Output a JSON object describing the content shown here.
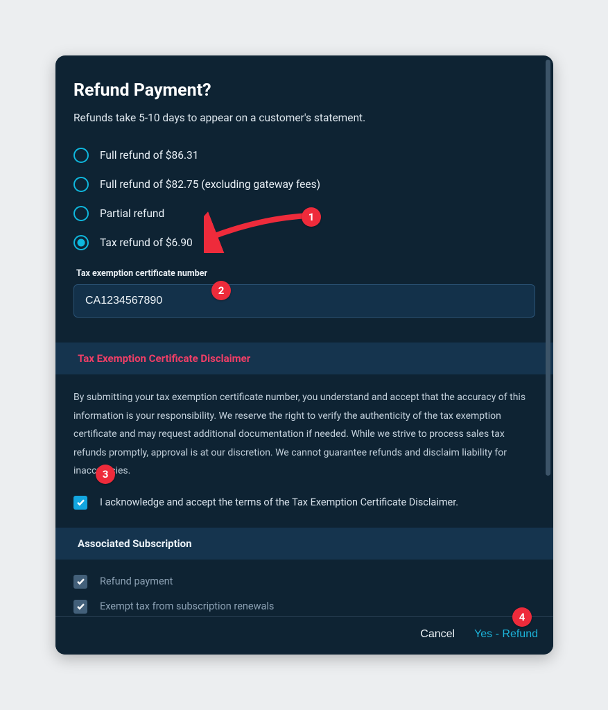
{
  "modal": {
    "title": "Refund Payment?",
    "subtitle": "Refunds take 5-10 days to appear on a customer's statement.",
    "options": [
      {
        "label": "Full refund of $86.31",
        "selected": false
      },
      {
        "label": "Full refund of $82.75 (excluding gateway fees)",
        "selected": false
      },
      {
        "label": "Partial refund",
        "selected": false
      },
      {
        "label": "Tax refund of $6.90",
        "selected": true
      }
    ],
    "cert_field": {
      "label": "Tax exemption certificate number",
      "value": "CA1234567890"
    },
    "disclaimer_heading": "Tax Exemption Certificate Disclaimer",
    "disclaimer_body": "By submitting your tax exemption certificate number, you understand and accept that the accuracy of this information is your responsibility. We reserve the right to verify the authenticity of the tax exemption certificate and may request additional documentation if needed. While we strive to process sales tax refunds promptly, approval is at our discretion. We cannot guarantee refunds and disclaim liability for inaccuracies.",
    "ack": {
      "checked": true,
      "label": "I acknowledge and accept the terms of the Tax Exemption Certificate Disclaimer."
    },
    "assoc_heading": "Associated Subscription",
    "assoc_items": [
      {
        "label": "Refund payment",
        "checked": true
      },
      {
        "label": "Exempt tax from subscription renewals",
        "checked": true
      }
    ],
    "buttons": {
      "cancel": "Cancel",
      "confirm": "Yes - Refund"
    }
  },
  "annotations": {
    "b1": "1",
    "b2": "2",
    "b3": "3",
    "b4": "4"
  }
}
